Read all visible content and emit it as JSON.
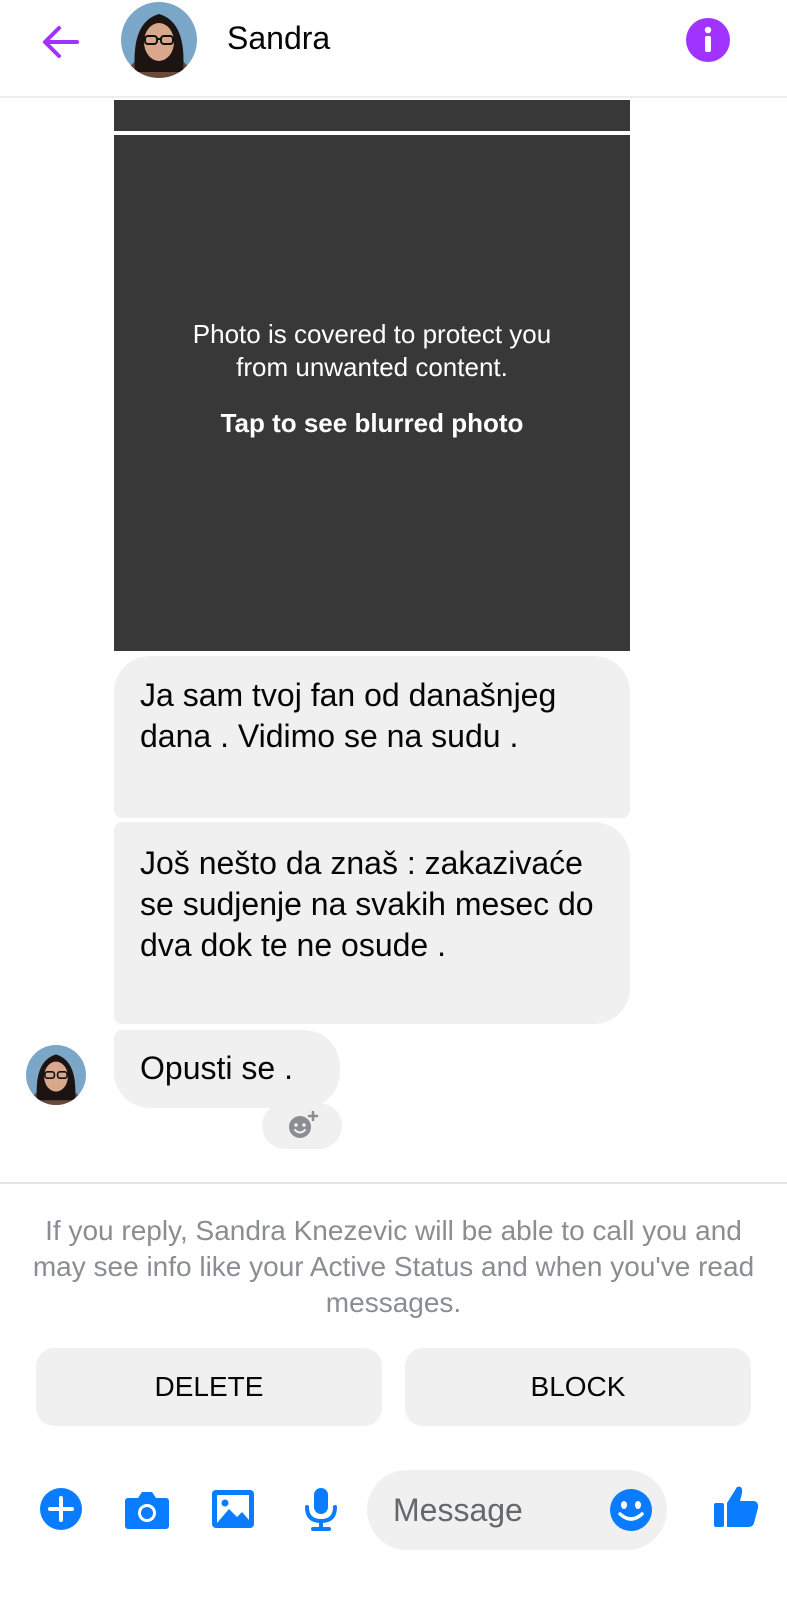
{
  "header": {
    "contact_name": "Sandra",
    "back_icon": "arrow-left-icon",
    "info_icon": "info-icon"
  },
  "photo": {
    "cover_text": "Photo is covered to protect you from unwanted content.",
    "tap_label": "Tap to see blurred photo"
  },
  "messages": [
    {
      "text": "Ja sam tvoj fan od današnjeg dana . Vidimo se na sudu ."
    },
    {
      "text": "Još nešto da znaš : zakazivaće se sudjenje na svakih mesec do dva dok te ne osude ."
    },
    {
      "text": "Opusti se ."
    }
  ],
  "reply_notice": "If you reply, Sandra Knezevic will be able to call you and may see info like your Active Status and when you've read messages.",
  "actions": {
    "delete_label": "DELETE",
    "block_label": "BLOCK"
  },
  "composer": {
    "placeholder": "Message",
    "icons": [
      "plus-icon",
      "camera-icon",
      "gallery-icon",
      "microphone-icon",
      "emoji-icon",
      "thumbs-up-icon"
    ]
  },
  "colors": {
    "accent_purple": "#a033ff",
    "composer_blue": "#0a7cff",
    "bubble_gray": "#f0f0f0",
    "photo_cover": "#383838"
  }
}
